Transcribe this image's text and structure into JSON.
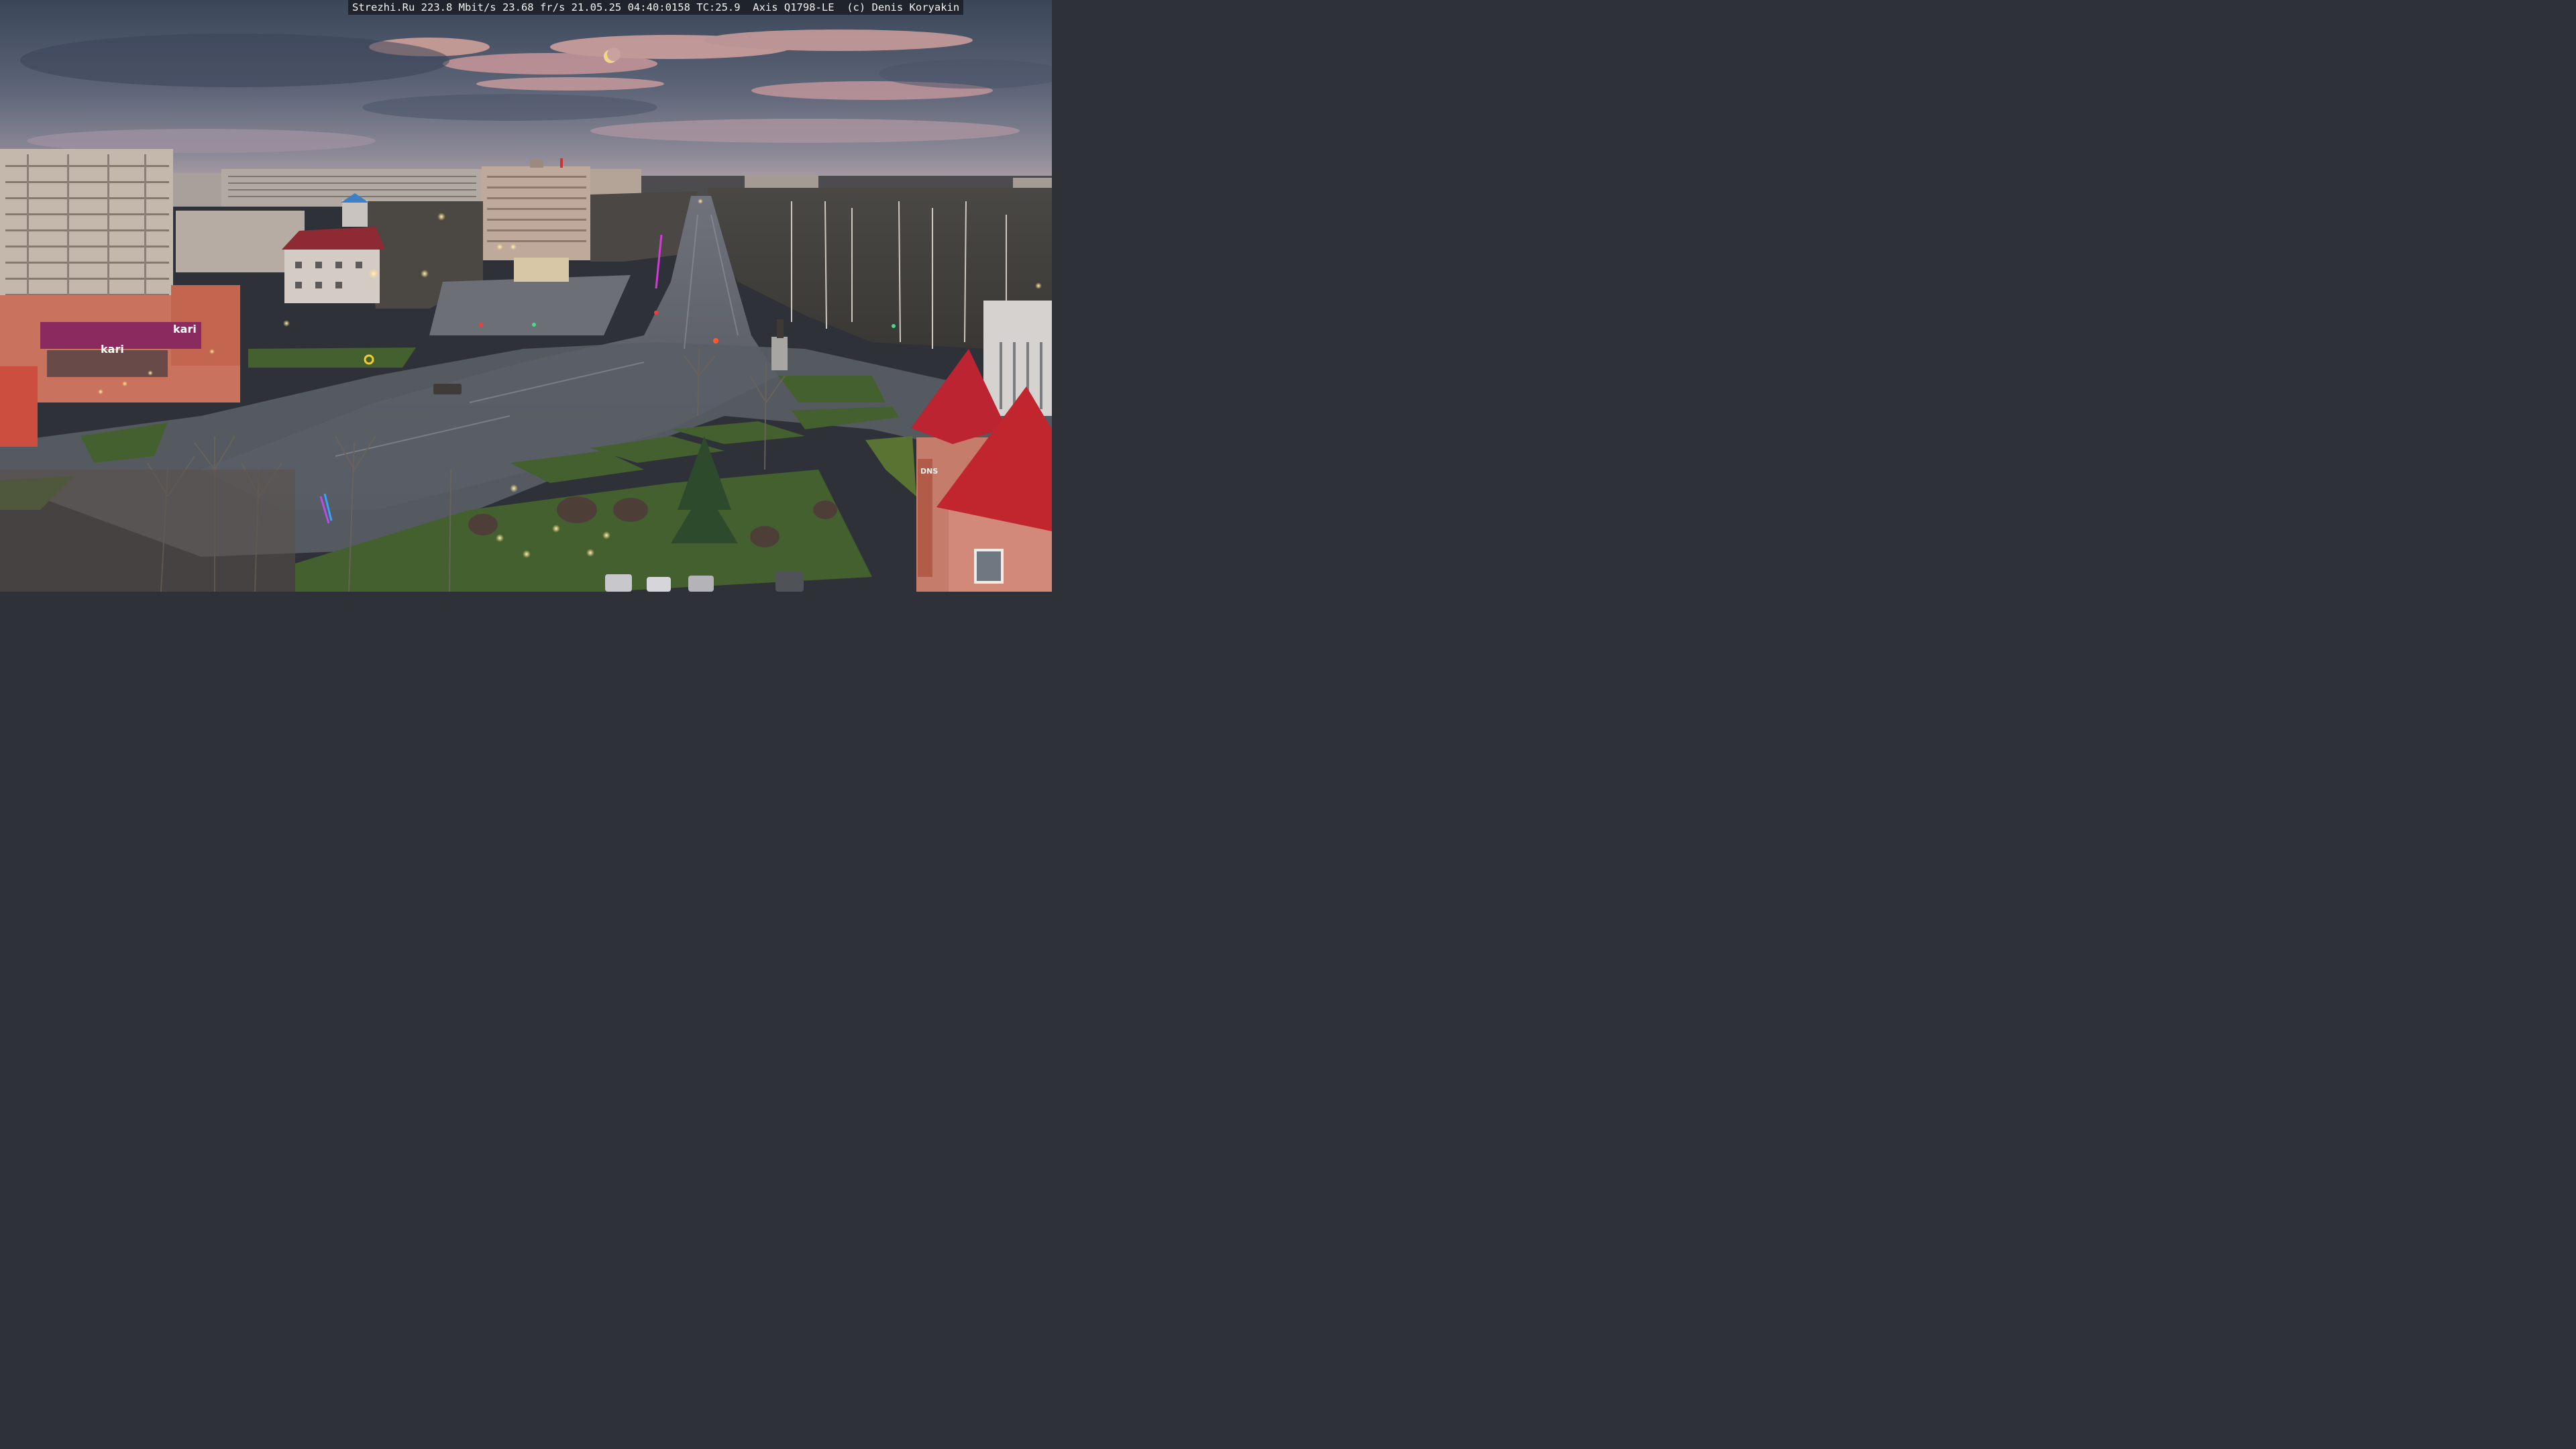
{
  "overlay": {
    "text": "Strezhi.Ru 223.8 Mbit/s 23.68 fr/s 21.05.25 04:40:0158 TC:25.9  Axis Q1798-LE  (c) Denis Koryakin"
  },
  "signage": {
    "kari_left": "kari",
    "kari_right": "kari",
    "dns": "DNS"
  },
  "colors": {
    "sky_top": "#3d4a5e",
    "sky_mid": "#6a7183",
    "sky_horizon": "#c7a9ab",
    "cloud_pink": "#d9a9a0",
    "road": "#565b63",
    "grass": "#3e5a33",
    "roof_red": "#b8242c",
    "building_pink": "#c87863"
  }
}
